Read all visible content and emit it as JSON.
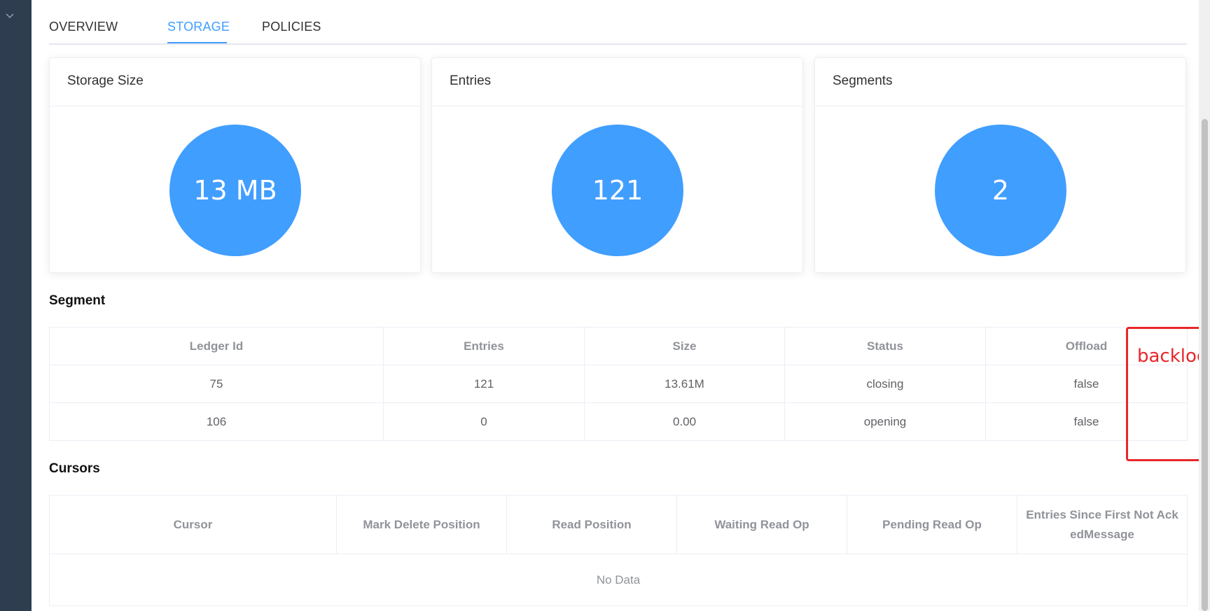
{
  "tabs": [
    {
      "label": "OVERVIEW"
    },
    {
      "label": "STORAGE"
    },
    {
      "label": "POLICIES"
    }
  ],
  "cards": [
    {
      "title": "Storage Size",
      "value": "13 MB"
    },
    {
      "title": "Entries",
      "value": "121"
    },
    {
      "title": "Segments",
      "value": "2"
    }
  ],
  "segment": {
    "title": "Segment",
    "columns": [
      "Ledger Id",
      "Entries",
      "Size",
      "Status",
      "Offload"
    ],
    "rows": [
      [
        "75",
        "121",
        "13.61M",
        "closing",
        "false"
      ],
      [
        "106",
        "0",
        "0.00",
        "opening",
        "false"
      ]
    ]
  },
  "cursors": {
    "title": "Cursors",
    "columns": [
      "Cursor",
      "Mark Delete Position",
      "Read Position",
      "Waiting Read Op",
      "Pending Read Op",
      "Entries Since First Not AckedMessage"
    ],
    "empty_text": "No Data"
  },
  "annotation": {
    "text": "backlog",
    "color": "#e8262a"
  },
  "colors": {
    "accent": "#409eff",
    "sidebar": "#2e3d50"
  }
}
